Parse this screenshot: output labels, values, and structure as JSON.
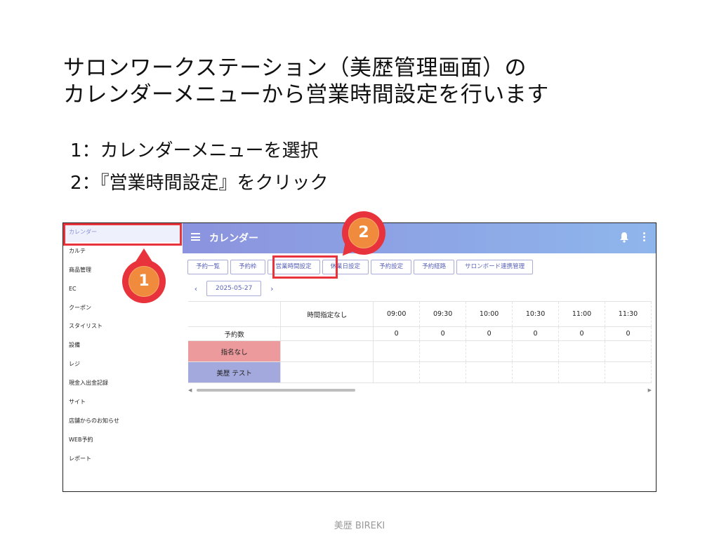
{
  "slide": {
    "title_lines": [
      "サロンワークステーション（美歴管理画面）の",
      "カレンダーメニューから営業時間設定を行います"
    ],
    "steps": [
      "1：カレンダーメニューを選択",
      "2：『営業時間設定』をクリック"
    ],
    "footer": "美歴 BIREKI"
  },
  "sidebar": {
    "items": [
      {
        "label": "カレンダー",
        "active": true
      },
      {
        "label": "カルテ"
      },
      {
        "label": "商品管理"
      },
      {
        "label": "EC"
      },
      {
        "label": "クーポン"
      },
      {
        "label": "スタイリスト"
      },
      {
        "label": "設備"
      },
      {
        "label": "レジ"
      },
      {
        "label": "現金入出金記録"
      },
      {
        "label": "サイト"
      },
      {
        "label": "店舗からのお知らせ"
      },
      {
        "label": "WEB予約"
      },
      {
        "label": "レポート"
      }
    ]
  },
  "appbar": {
    "title": "カレンダー",
    "icons": [
      "menu-icon",
      "bell-icon",
      "kebab-icon"
    ],
    "gradient": [
      "#8b93de",
      "#8fb6ec"
    ]
  },
  "tabs": [
    "予約一覧",
    "予約枠",
    "営業時間設定",
    "休業日設定",
    "予約設定",
    "予約経路",
    "サロンボード連携管理"
  ],
  "date_nav": {
    "date": "2025-05-27",
    "prev": "‹",
    "next": "›"
  },
  "table": {
    "columns": [
      "",
      "時間指定なし",
      "09:00",
      "09:30",
      "10:00",
      "10:30",
      "11:00",
      "11:30"
    ],
    "count_row": {
      "label": "予約数",
      "values": [
        "",
        "0",
        "0",
        "0",
        "0",
        "0",
        "0"
      ]
    },
    "staff": [
      {
        "name": "指名なし",
        "color": "#ed9a9d"
      },
      {
        "name": "美歴 テスト",
        "color": "#a3a8dd"
      }
    ]
  },
  "markers": {
    "one": "1",
    "two": "2",
    "highlight_color": "#e8333c",
    "marker_fill": "#f08a3c"
  }
}
